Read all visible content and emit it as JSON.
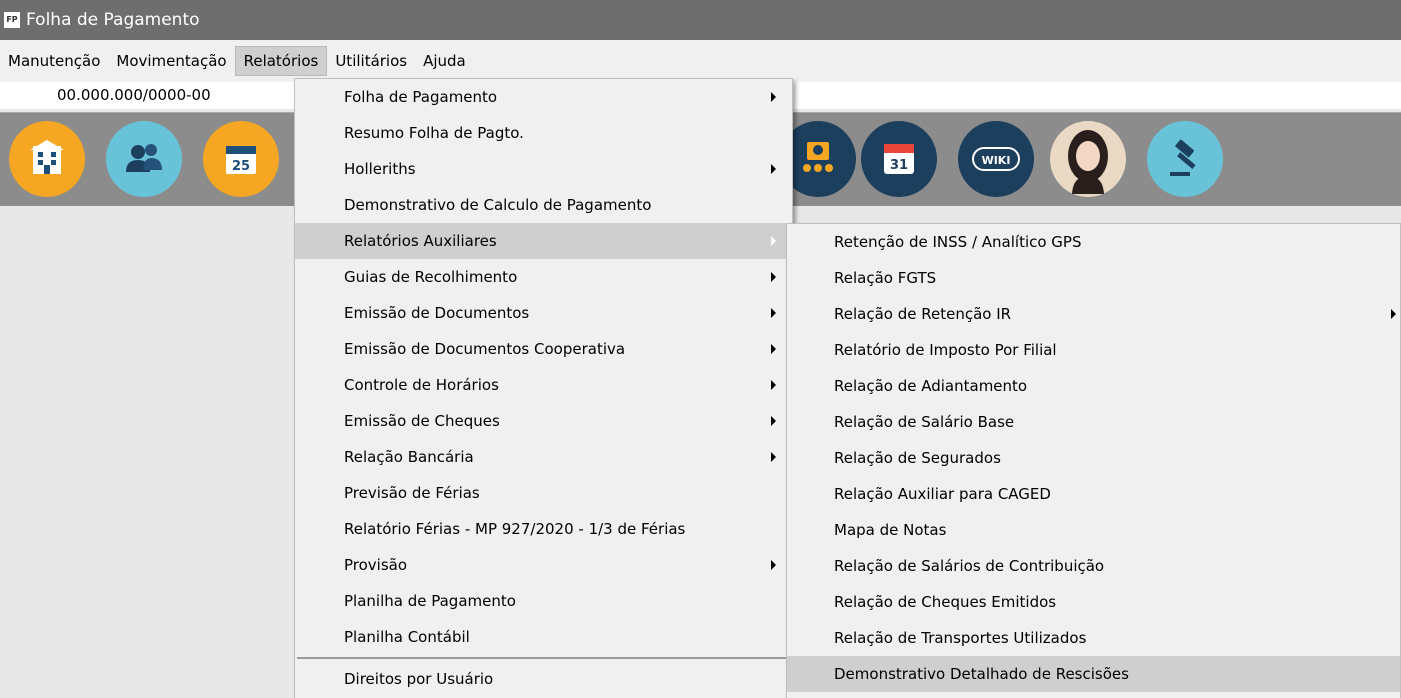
{
  "titlebar": {
    "icon_text": "FP",
    "title": "Folha de Pagamento"
  },
  "menubar": [
    {
      "label": "Manutenção",
      "active": false
    },
    {
      "label": "Movimentação",
      "active": false
    },
    {
      "label": "Relatórios",
      "active": true
    },
    {
      "label": "Utilitários",
      "active": false
    },
    {
      "label": "Ajuda",
      "active": false
    }
  ],
  "cnpj": "00.000.000/0000-00",
  "toolbar": [
    {
      "name": "company-icon",
      "color": "orange"
    },
    {
      "name": "employees-icon",
      "color": "teal"
    },
    {
      "name": "calendar-25-icon",
      "color": "orange"
    },
    {
      "name": "employee-group-icon",
      "color": "navy"
    },
    {
      "name": "calendar-31-icon",
      "color": "navy"
    },
    {
      "name": "wiki-icon",
      "color": "navy"
    },
    {
      "name": "assistant-avatar-icon",
      "color": "orange"
    },
    {
      "name": "gavel-icon",
      "color": "teal"
    }
  ],
  "relatorios_menu": [
    {
      "label": "Folha de Pagamento",
      "submenu": true
    },
    {
      "label": "Resumo Folha de Pagto.",
      "submenu": false
    },
    {
      "label": "Holleriths",
      "submenu": true
    },
    {
      "label": "Demonstrativo de Calculo de Pagamento",
      "submenu": false
    },
    {
      "label": "Relatórios Auxiliares",
      "submenu": true,
      "highlighted": true
    },
    {
      "label": "Guias de Recolhimento",
      "submenu": true
    },
    {
      "label": "Emissão de Documentos",
      "submenu": true
    },
    {
      "label": "Emissão de Documentos Cooperativa",
      "submenu": true
    },
    {
      "label": "Controle de Horários",
      "submenu": true
    },
    {
      "label": "Emissão de Cheques",
      "submenu": true
    },
    {
      "label": "Relação Bancária",
      "submenu": true
    },
    {
      "label": "Previsão de Férias",
      "submenu": false
    },
    {
      "label": "Relatório Férias - MP 927/2020 - 1/3 de Férias",
      "submenu": false
    },
    {
      "label": "Provisão",
      "submenu": true
    },
    {
      "label": "Planilha de Pagamento",
      "submenu": false
    },
    {
      "label": "Planilha Contábil",
      "submenu": false
    },
    {
      "separator": true
    },
    {
      "label": "Direitos por Usuário",
      "submenu": false
    }
  ],
  "auxiliares_menu": [
    {
      "label": "Retenção de INSS / Analítico GPS",
      "submenu": false
    },
    {
      "label": "Relação FGTS",
      "submenu": false
    },
    {
      "label": "Relação de Retenção IR",
      "submenu": true
    },
    {
      "label": "Relatório de Imposto Por Filial",
      "submenu": false
    },
    {
      "label": "Relação de Adiantamento",
      "submenu": false
    },
    {
      "label": "Relação de Salário Base",
      "submenu": false
    },
    {
      "label": "Relação de Segurados",
      "submenu": false
    },
    {
      "label": "Relação Auxiliar para CAGED",
      "submenu": false
    },
    {
      "label": "Mapa de Notas",
      "submenu": false
    },
    {
      "label": "Relação de Salários de Contribuição",
      "submenu": false
    },
    {
      "label": "Relação de Cheques Emitidos",
      "submenu": false
    },
    {
      "label": "Relação de Transportes Utilizados",
      "submenu": false
    },
    {
      "label": "Demonstrativo Detalhado de Rescisões",
      "submenu": false,
      "highlighted": true
    }
  ]
}
